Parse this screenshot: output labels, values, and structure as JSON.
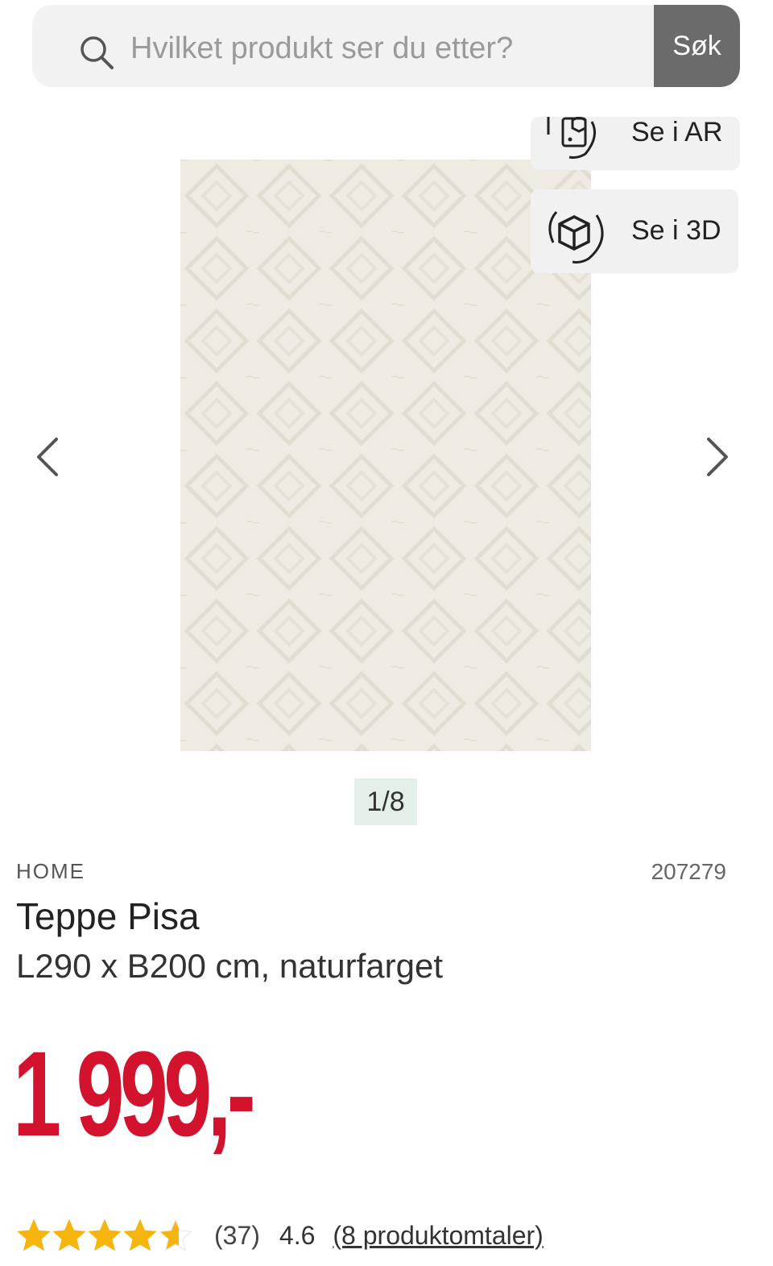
{
  "search": {
    "placeholder": "Hvilket produkt ser du etter?",
    "button_label": "Søk"
  },
  "gallery": {
    "view_ar_label": "Se i AR",
    "view_3d_label": "Se i 3D",
    "counter": "1/8",
    "image_color": "#efebe1"
  },
  "product": {
    "brand": "HOME",
    "sku": "207279",
    "title": "Teppe Pisa",
    "subtitle": "L290 x B200 cm, naturfarget",
    "price": "1 999,-",
    "price_color": "#d3122e"
  },
  "rating": {
    "stars_value": 4.6,
    "stars_max": 5,
    "count_text": "(37)",
    "value_text": "4.6",
    "reviews_link": "(8 produktomtaler)",
    "star_color": "#f5b50c"
  },
  "icons": {
    "search": "search-icon",
    "ar": "ar-icon",
    "cube": "3d-cube-icon",
    "prev": "chevron-left-icon",
    "next": "chevron-right-icon",
    "star": "star-icon"
  }
}
